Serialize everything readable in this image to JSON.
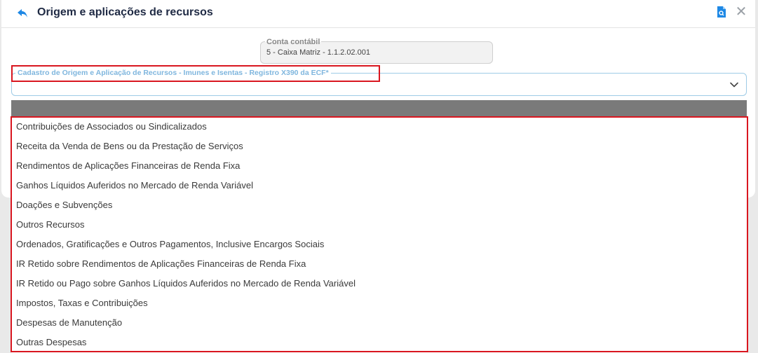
{
  "dialog": {
    "title": "Origem e aplicações de recursos"
  },
  "conta": {
    "label": "Conta contábil",
    "value": "5 - Caixa Matriz  - 1.1.2.02.001"
  },
  "select": {
    "label": "Cadastro de Origem e Aplicação de Recursos - Imunes e Isentas - Registro X390 da ECF*"
  },
  "dropdown": {
    "items": [
      "Contribuições de Associados ou Sindicalizados",
      "Receita da Venda de Bens ou da Prestação de Serviços",
      "Rendimentos de Aplicações Financeiras de Renda Fixa",
      "Ganhos Líquidos Auferidos no Mercado de Renda Variável",
      "Doações e Subvenções",
      "Outros Recursos",
      "Ordenados, Gratificações e Outros Pagamentos, Inclusive Encargos Sociais",
      "IR Retido sobre Rendimentos de Aplicações Financeiras de Renda Fixa",
      "IR Retido ou Pago sobre Ganhos Líquidos Auferidos no Mercado de Renda Variável",
      "Impostos, Taxas e Contribuições",
      "Despesas de Manutenção",
      "Outras Despesas"
    ]
  },
  "colors": {
    "accent": "#1e88e5",
    "highlight": "#d9161f",
    "label_blue": "#7fb6de"
  },
  "icons": {
    "back": "back-arrow-icon",
    "document": "document-search-icon",
    "close": "close-icon",
    "chevron": "chevron-down-icon"
  }
}
